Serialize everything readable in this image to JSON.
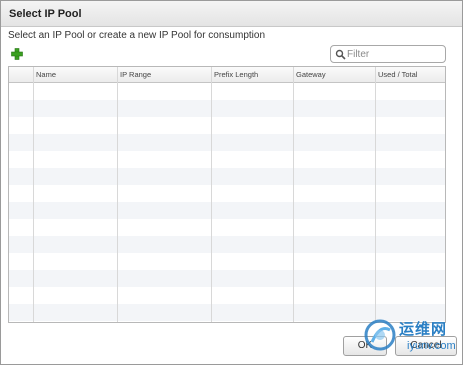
{
  "dialog": {
    "title": "Select IP Pool",
    "instruction": "Select an IP Pool or create a new IP Pool for consumption"
  },
  "filter": {
    "placeholder": "Filter",
    "value": ""
  },
  "toolbar": {
    "add_icon": "plus-icon",
    "add_color": "#3aa020"
  },
  "table": {
    "columns": [
      "",
      "Name",
      "IP Range",
      "Prefix Length",
      "Gateway",
      "Used / Total"
    ],
    "rows": []
  },
  "footer": {
    "ok_label": "OK",
    "cancel_label": "Cancel"
  },
  "watermark": {
    "cn": "运维网",
    "en": "iyunv.com"
  }
}
